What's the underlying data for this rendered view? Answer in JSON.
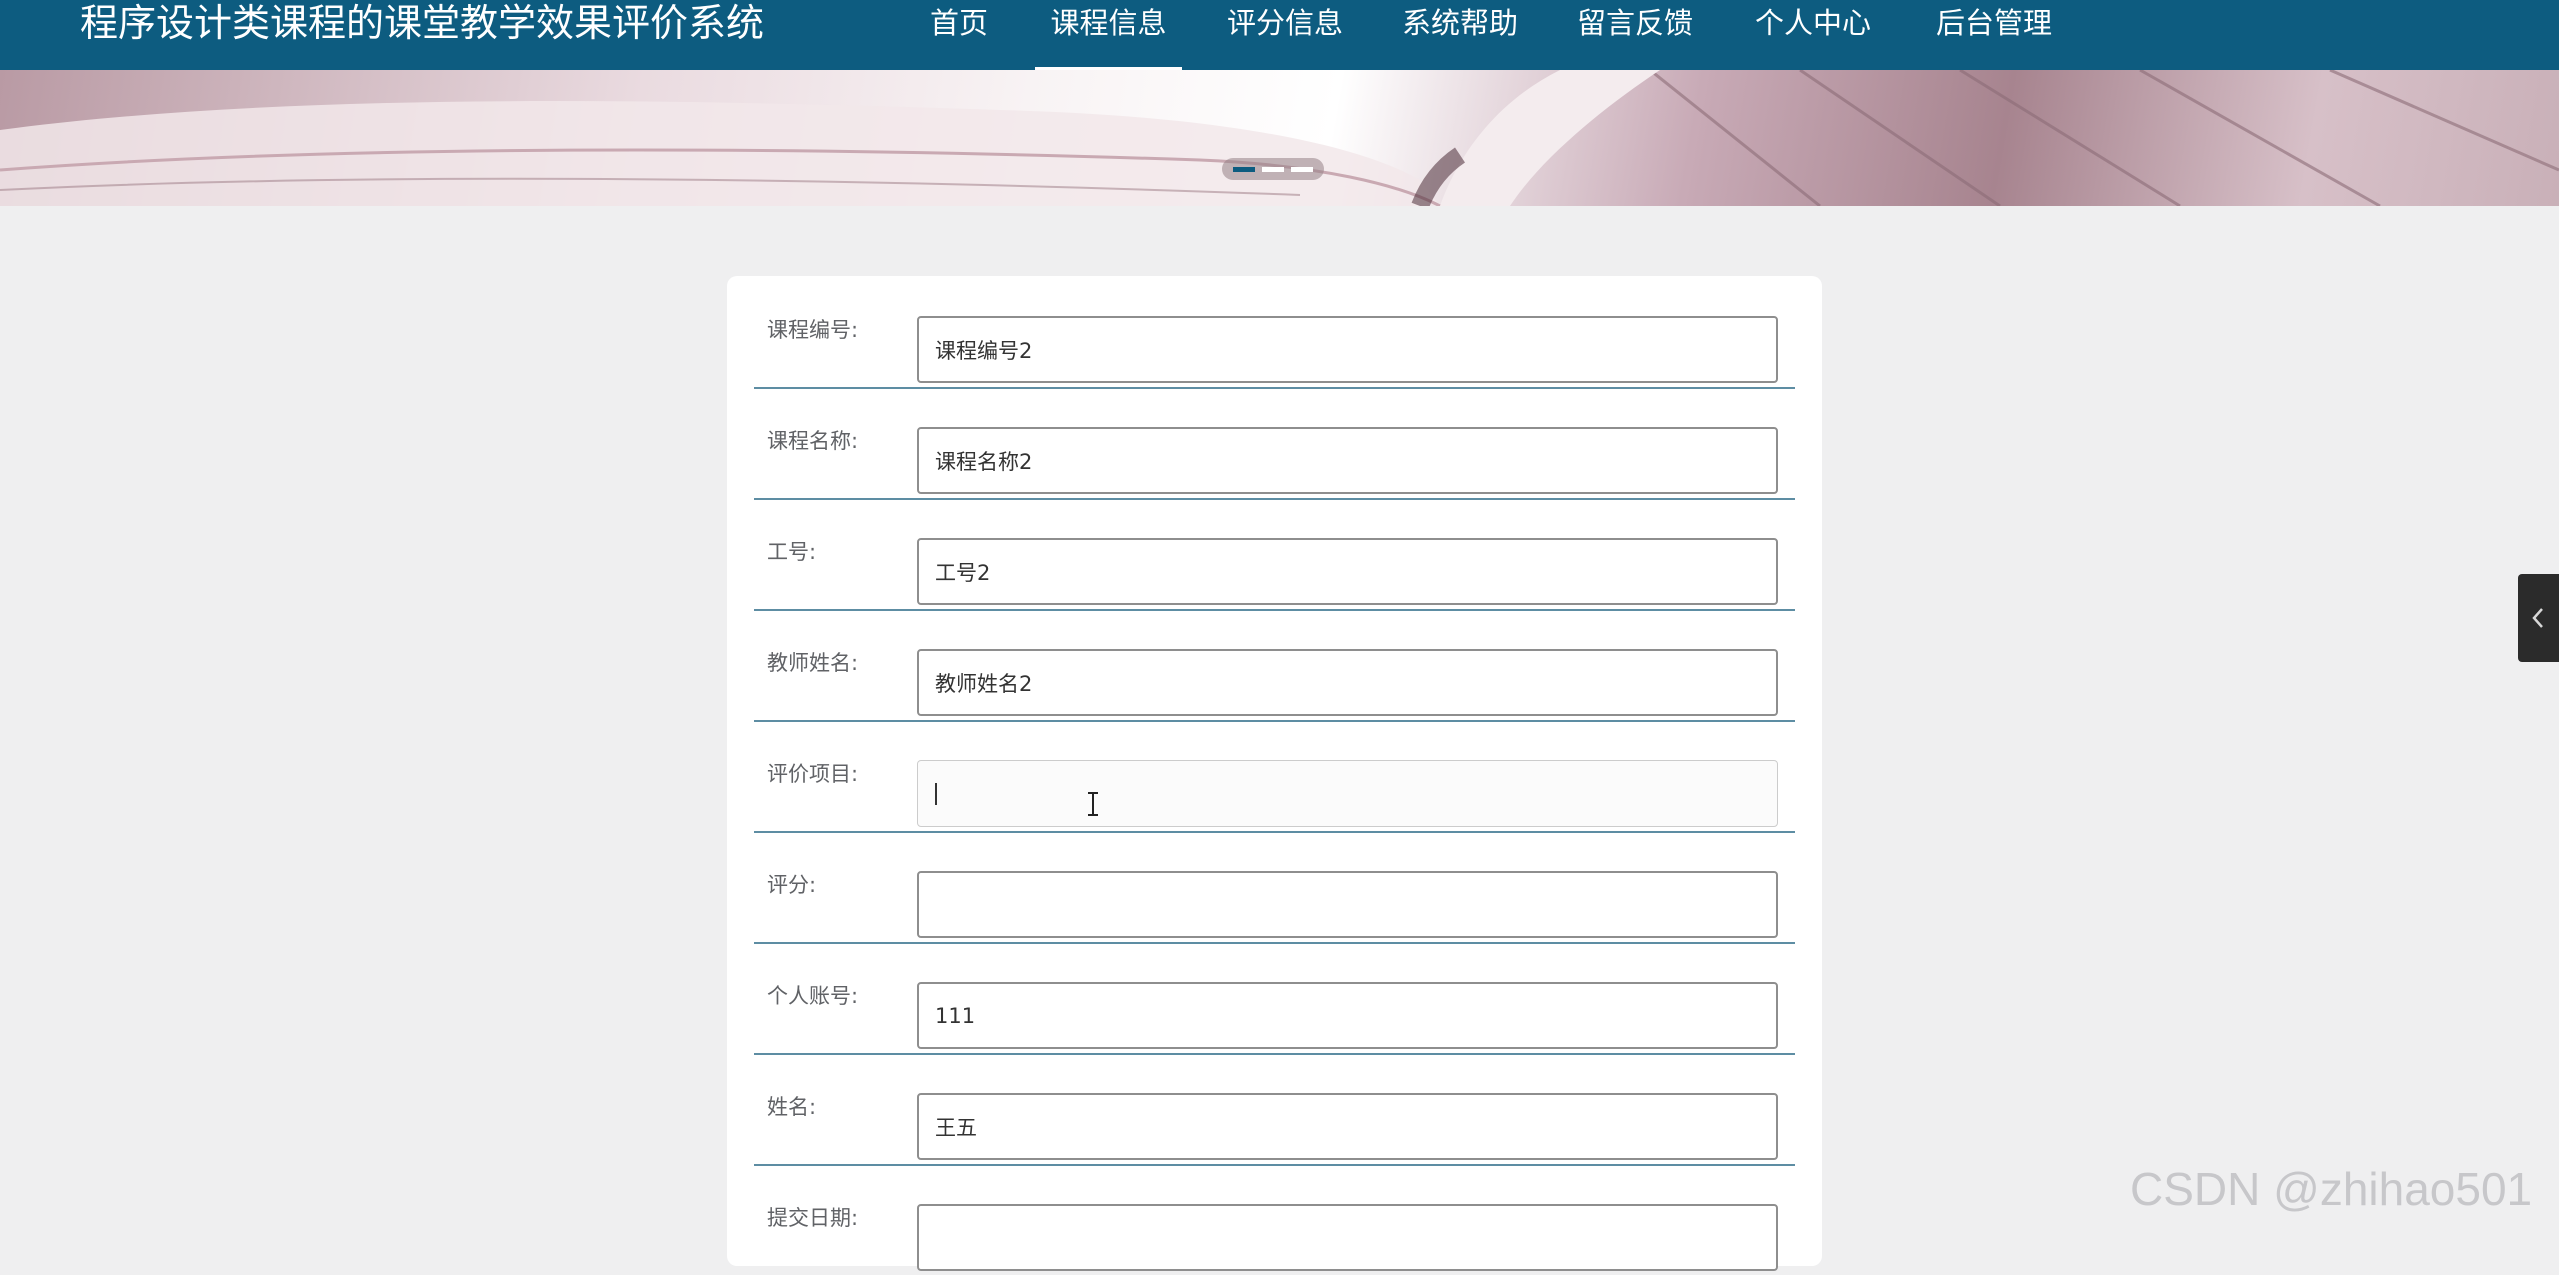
{
  "header": {
    "site_title": "程序设计类课程的课堂教学效果评价系统",
    "nav": [
      {
        "label": "首页",
        "active": false
      },
      {
        "label": "课程信息",
        "active": true
      },
      {
        "label": "评分信息",
        "active": false
      },
      {
        "label": "系统帮助",
        "active": false
      },
      {
        "label": "留言反馈",
        "active": false
      },
      {
        "label": "个人中心",
        "active": false
      },
      {
        "label": "后台管理",
        "active": false
      }
    ],
    "background_color": "#0d5c80"
  },
  "banner": {
    "slide_count": 3,
    "active_slide": 1
  },
  "form": {
    "fields": [
      {
        "label": "课程编号:",
        "value": "课程编号2"
      },
      {
        "label": "课程名称:",
        "value": "课程名称2"
      },
      {
        "label": "工号:",
        "value": "工号2"
      },
      {
        "label": "教师姓名:",
        "value": "教师姓名2"
      },
      {
        "label": "评价项目:",
        "value": ""
      },
      {
        "label": "评分:",
        "value": ""
      },
      {
        "label": "个人账号:",
        "value": "111"
      },
      {
        "label": "姓名:",
        "value": "王五"
      },
      {
        "label": "提交日期:",
        "value": ""
      }
    ],
    "focused_field": "评价项目:",
    "divider_color": "#5d8da3"
  },
  "side_tab": {
    "icon": "chevron-left-icon"
  },
  "watermark": "CSDN @zhihao501"
}
